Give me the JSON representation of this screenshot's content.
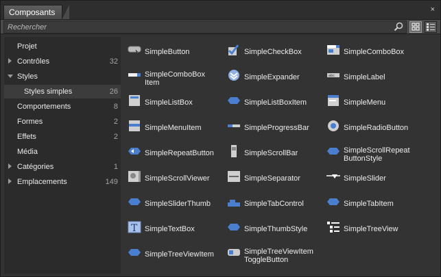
{
  "panel": {
    "tab_title": "Composants",
    "close_glyph": "×"
  },
  "search": {
    "placeholder": "Rechercher"
  },
  "sidebar": {
    "items": [
      {
        "label": "Projet",
        "count": "",
        "arrow": "none",
        "indent": 0
      },
      {
        "label": "Contrôles",
        "count": "32",
        "arrow": "closed",
        "indent": 0
      },
      {
        "label": "Styles",
        "count": "",
        "arrow": "open",
        "indent": 0
      },
      {
        "label": "Styles simples",
        "count": "26",
        "arrow": "none",
        "indent": 1,
        "selected": true
      },
      {
        "label": "Comportements",
        "count": "8",
        "arrow": "none",
        "indent": 0
      },
      {
        "label": "Formes",
        "count": "2",
        "arrow": "none",
        "indent": 0
      },
      {
        "label": "Effets",
        "count": "2",
        "arrow": "none",
        "indent": 0
      },
      {
        "label": "Média",
        "count": "",
        "arrow": "none",
        "indent": 0
      },
      {
        "label": "Catégories",
        "count": "1",
        "arrow": "closed",
        "indent": 0
      },
      {
        "label": "Emplacements",
        "count": "149",
        "arrow": "closed",
        "indent": 0
      }
    ]
  },
  "components": [
    {
      "line1": "SimpleButton",
      "line2": "",
      "icon": "button-icon"
    },
    {
      "line1": "SimpleCheckBox",
      "line2": "",
      "icon": "checkbox-icon"
    },
    {
      "line1": "SimpleComboBox",
      "line2": "",
      "icon": "combobox-icon"
    },
    {
      "line1": "SimpleComboBox",
      "line2": "Item",
      "icon": "combobox-item-icon"
    },
    {
      "line1": "SimpleExpander",
      "line2": "",
      "icon": "expander-icon"
    },
    {
      "line1": "SimpleLabel",
      "line2": "",
      "icon": "label-icon"
    },
    {
      "line1": "SimpleListBox",
      "line2": "",
      "icon": "listbox-icon"
    },
    {
      "line1": "SimpleListBoxItem",
      "line2": "",
      "icon": "listbox-item-icon"
    },
    {
      "line1": "SimpleMenu",
      "line2": "",
      "icon": "menu-icon"
    },
    {
      "line1": "SimpleMenuItem",
      "line2": "",
      "icon": "menu-item-icon"
    },
    {
      "line1": "SimpleProgressBar",
      "line2": "",
      "icon": "progressbar-icon"
    },
    {
      "line1": "SimpleRadioButton",
      "line2": "",
      "icon": "radiobutton-icon"
    },
    {
      "line1": "SimpleRepeatButton",
      "line2": "",
      "icon": "repeatbutton-icon"
    },
    {
      "line1": "SimpleScrollBar",
      "line2": "",
      "icon": "scrollbar-icon"
    },
    {
      "line1": "SimpleScrollRepeat",
      "line2": "ButtonStyle",
      "icon": "scrollrepeat-icon"
    },
    {
      "line1": "SimpleScrollViewer",
      "line2": "",
      "icon": "scrollviewer-icon"
    },
    {
      "line1": "SimpleSeparator",
      "line2": "",
      "icon": "separator-icon"
    },
    {
      "line1": "SimpleSlider",
      "line2": "",
      "icon": "slider-icon"
    },
    {
      "line1": "SimpleSliderThumb",
      "line2": "",
      "icon": "sliderthumb-icon"
    },
    {
      "line1": "SimpleTabControl",
      "line2": "",
      "icon": "tabcontrol-icon"
    },
    {
      "line1": "SimpleTabItem",
      "line2": "",
      "icon": "tabitem-icon"
    },
    {
      "line1": "SimpleTextBox",
      "line2": "",
      "icon": "textbox-icon"
    },
    {
      "line1": "SimpleThumbStyle",
      "line2": "",
      "icon": "thumbstyle-icon"
    },
    {
      "line1": "SimpleTreeView",
      "line2": "",
      "icon": "treeview-icon"
    },
    {
      "line1": "SimpleTreeViewItem",
      "line2": "",
      "icon": "treeview-item-icon"
    },
    {
      "line1": "SimpleTreeViewItem",
      "line2": "ToggleButton",
      "icon": "togglebutton-icon"
    }
  ],
  "colors": {
    "accent": "#4a7fd0",
    "panel_bg": "#333333",
    "sidebar_bg": "#2b2b2b"
  }
}
